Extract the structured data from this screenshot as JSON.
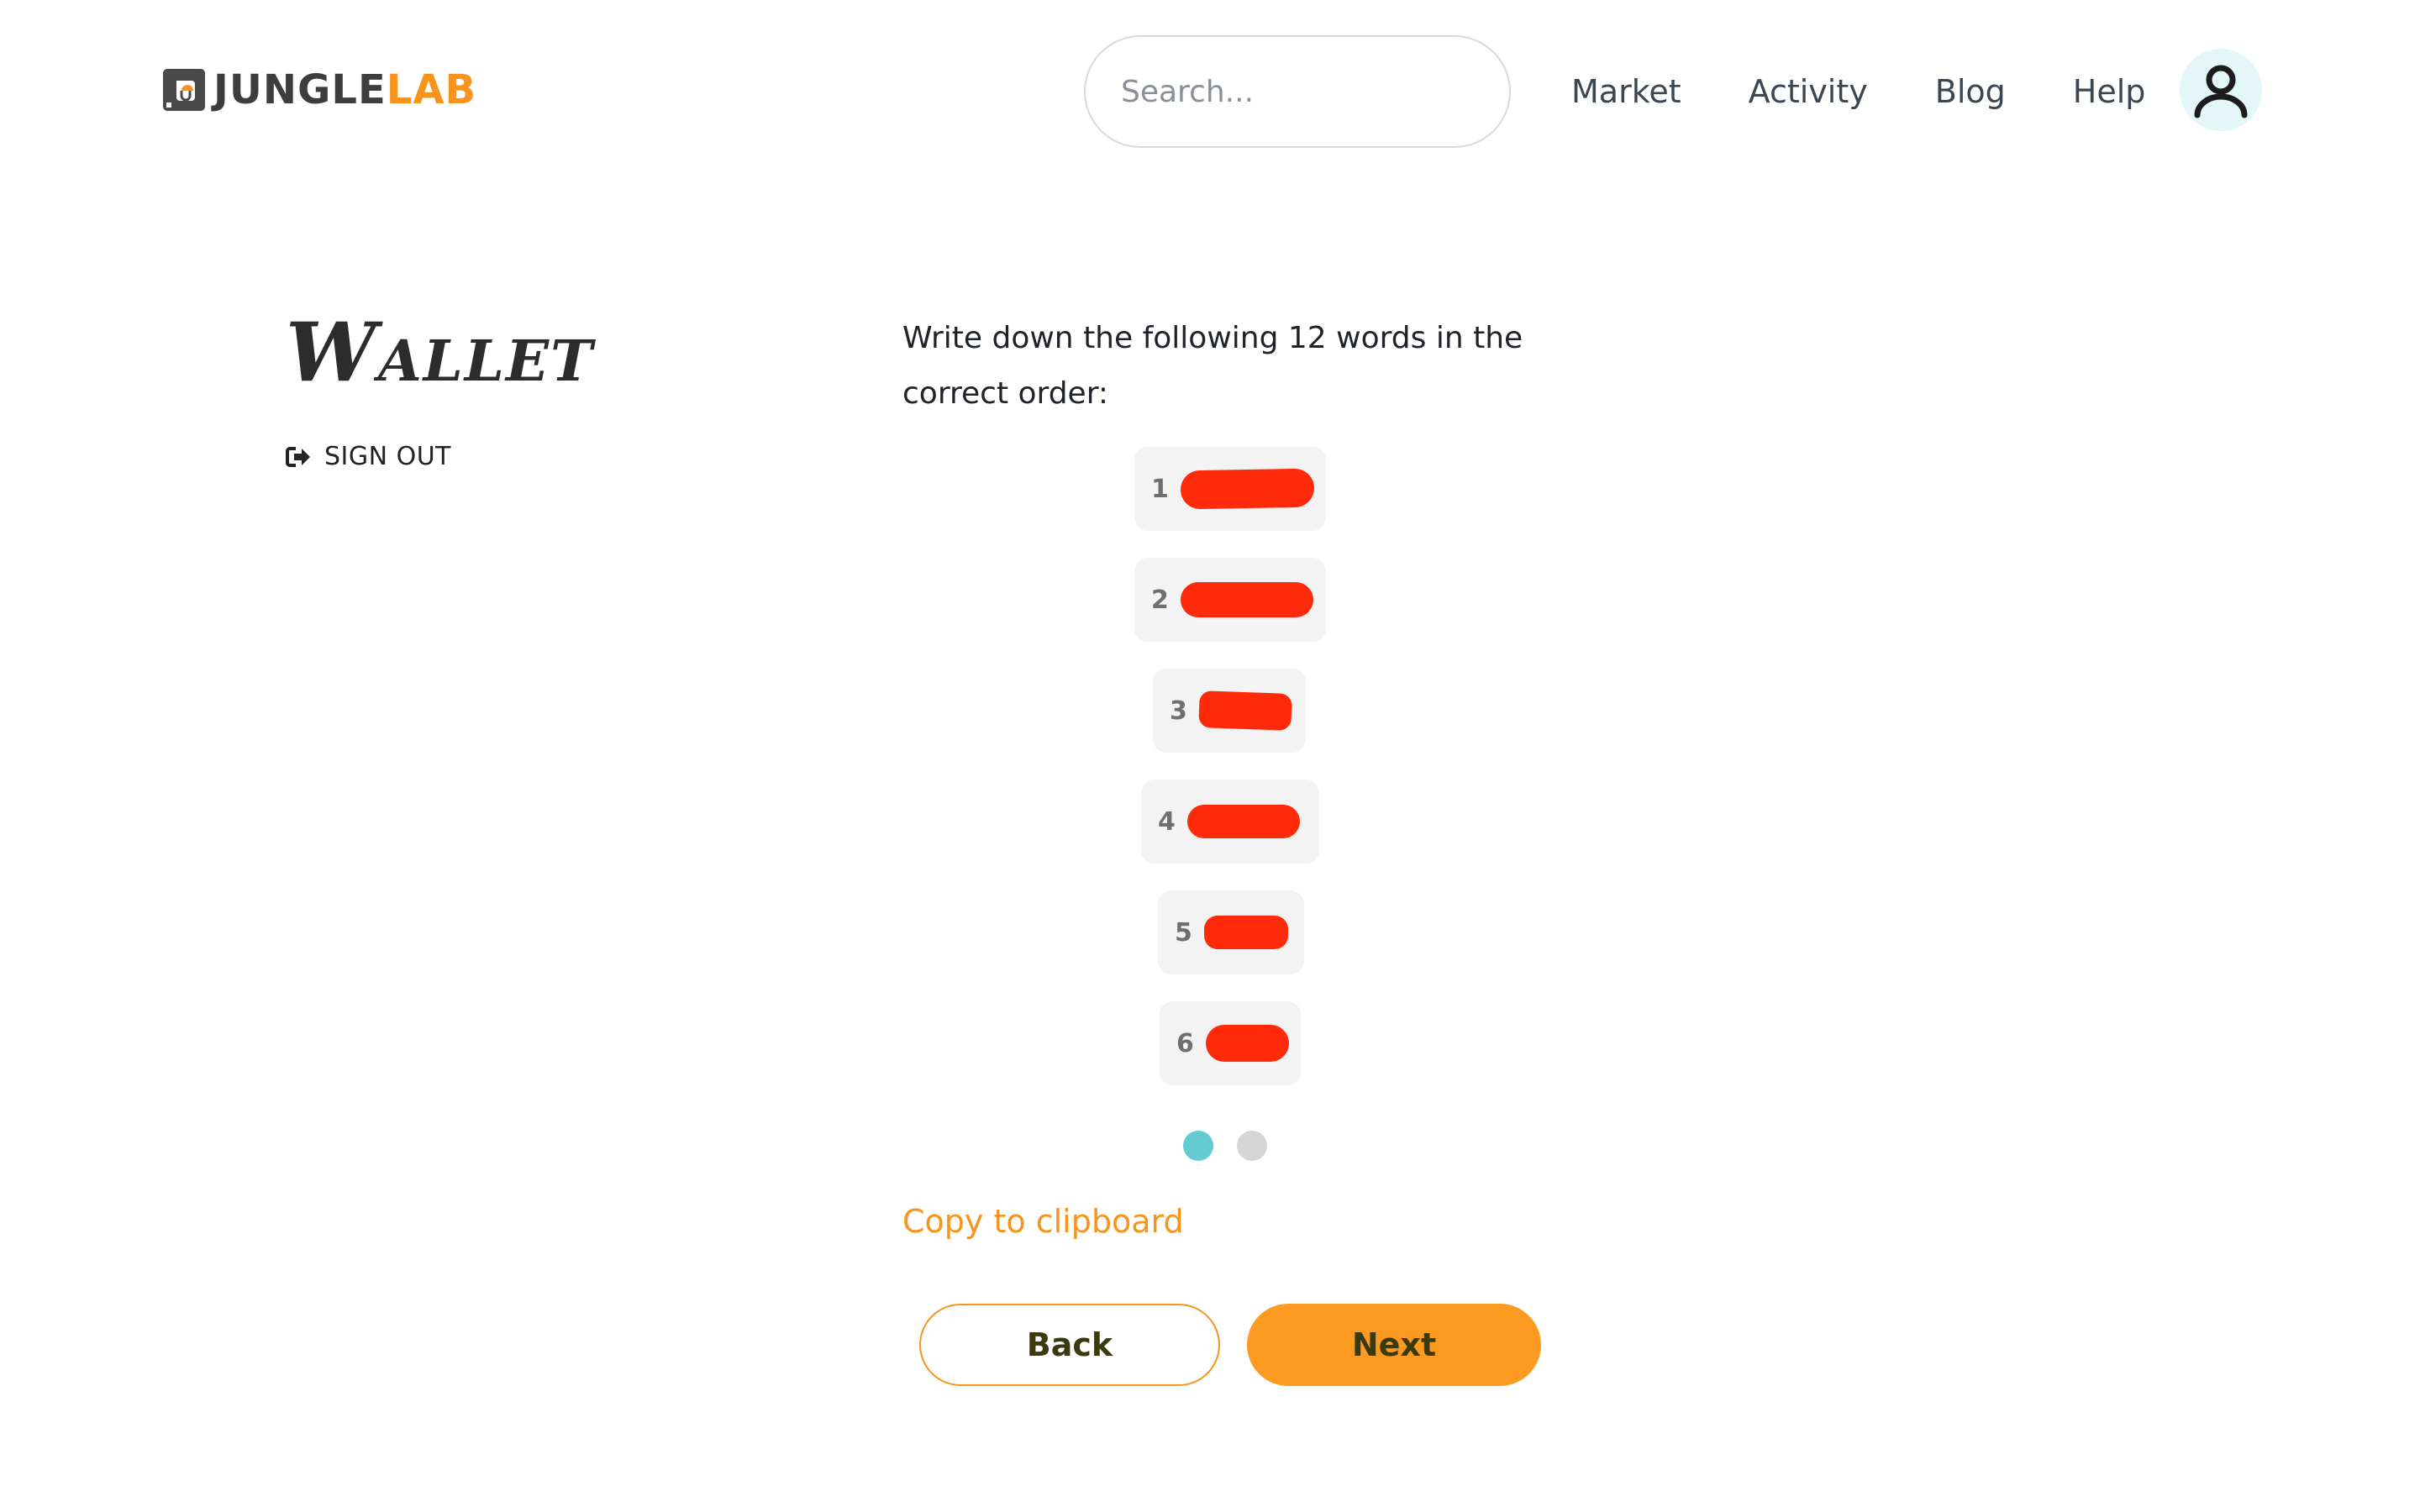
{
  "header": {
    "logo": {
      "part1": "JUNGLE",
      "part2": "LAB"
    },
    "search": {
      "placeholder": "Search...",
      "value": ""
    },
    "nav": [
      {
        "label": "Market"
      },
      {
        "label": "Activity"
      },
      {
        "label": "Blog"
      },
      {
        "label": "Help"
      }
    ],
    "avatar_icon": "user-icon"
  },
  "sidebar": {
    "title": "Wallet",
    "signout_label": "SIGN OUT",
    "signout_icon": "sign-out-icon"
  },
  "main": {
    "instructions": "Write down the following 12 words in the correct order:",
    "words": [
      {
        "index": "1",
        "redacted": true
      },
      {
        "index": "2",
        "redacted": true
      },
      {
        "index": "3",
        "redacted": true
      },
      {
        "index": "4",
        "redacted": true
      },
      {
        "index": "5",
        "redacted": true
      },
      {
        "index": "6",
        "redacted": true
      }
    ],
    "pager": {
      "pages": 2,
      "current": 1
    },
    "copy_label": "Copy to clipboard",
    "back_label": "Back",
    "next_label": "Next"
  },
  "colors": {
    "accent": "#f7941d",
    "button_fill": "#fd9a21",
    "active_dot": "#63ccd3",
    "inactive_dot": "#d6d6d6",
    "redaction": "#ff2a0a",
    "word_bg": "#f3f3f3"
  }
}
